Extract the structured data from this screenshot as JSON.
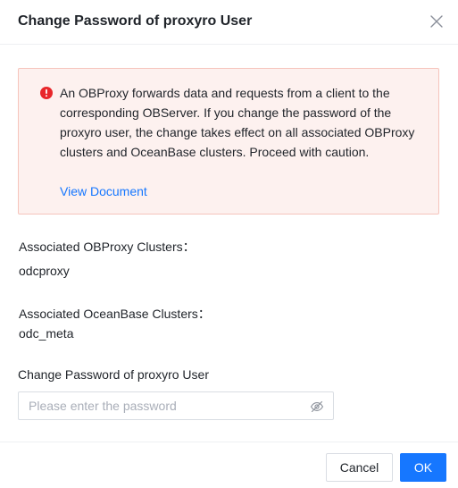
{
  "dialog": {
    "title": "Change Password of proxyro User"
  },
  "alert": {
    "message": "An OBProxy forwards data and requests from a client to the corresponding OBServer. If you change the password of the proxyro user, the change takes effect on all associated OBProxy clusters and OceanBase clusters. Proceed with caution.",
    "link_label": "View Document",
    "color": "#f53f3f"
  },
  "obproxy_clusters": {
    "label": "Associated OBProxy Clusters：",
    "value": "odcproxy"
  },
  "oceanbase_clusters": {
    "label": "Associated OceanBase Clusters：",
    "value": "odc_meta"
  },
  "password": {
    "label": "Change Password of proxyro User",
    "value": "",
    "placeholder": "Please enter the password",
    "visibility_icon": "eye-invisible-icon"
  },
  "footer": {
    "cancel_label": "Cancel",
    "ok_label": "OK",
    "primary_color": "#1677ff"
  }
}
